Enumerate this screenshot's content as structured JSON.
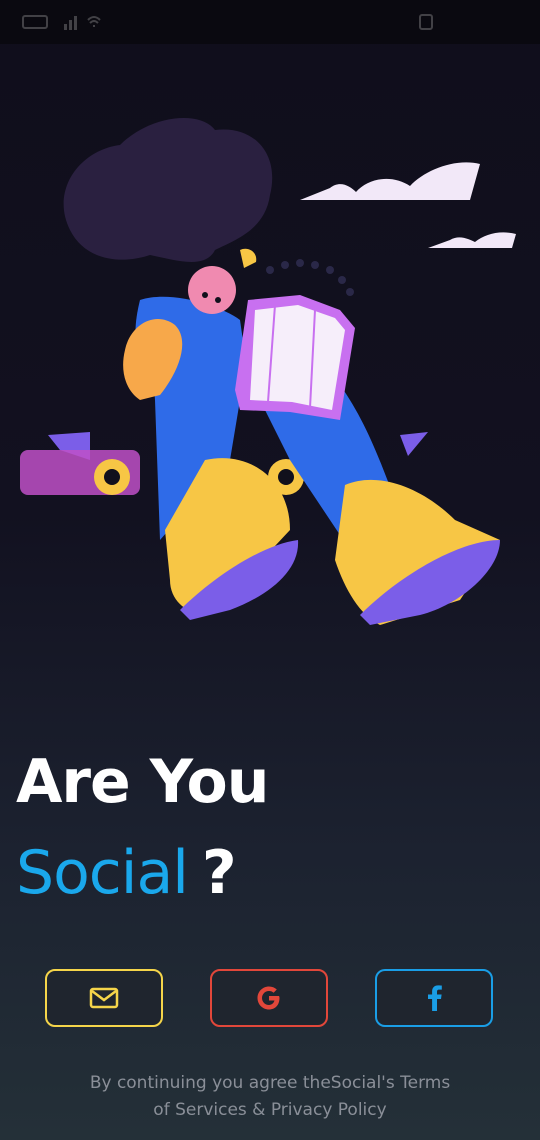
{
  "headline": {
    "line1": "Are You",
    "line2_accent": "Social",
    "line2_suffix": "?"
  },
  "buttons": [
    {
      "icon": "mail-icon",
      "color": "#f5d54a"
    },
    {
      "icon": "google-icon",
      "color": "#e2473a"
    },
    {
      "icon": "facebook-icon",
      "color": "#1a9ee6"
    }
  ],
  "terms": {
    "line1": "By continuing you agree theSocial's Terms",
    "line2": "of Services & Privacy Policy"
  },
  "colors": {
    "accent_blue": "#1aa8ec",
    "background": "#121120"
  }
}
